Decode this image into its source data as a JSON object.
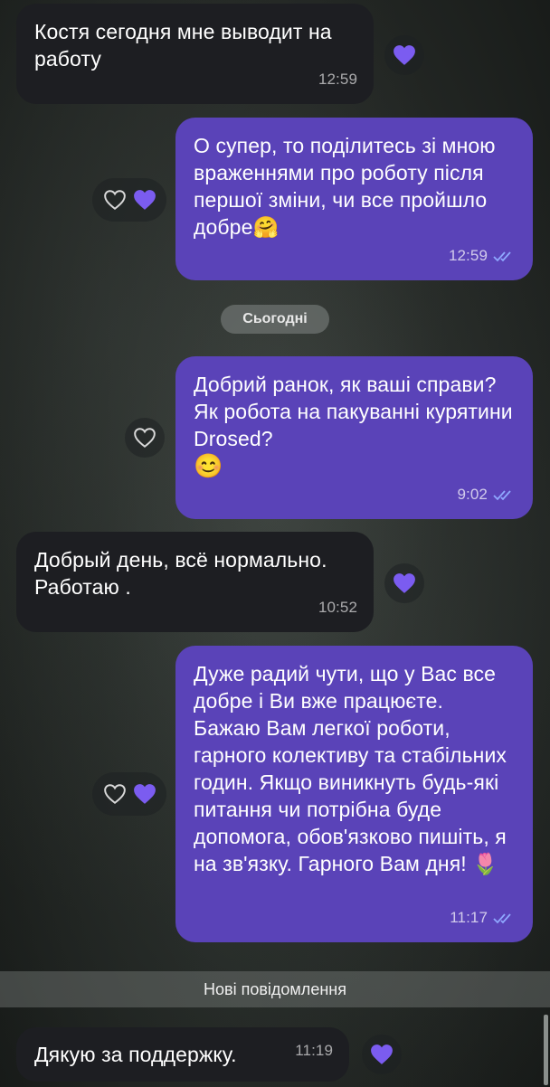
{
  "messages": [
    {
      "text": "Костя сегодня мне выводит на работу",
      "time": "12:59"
    },
    {
      "text": "О супер, то поділитесь зі мною враженнями про роботу після першої зміни, чи все пройшло добре🤗",
      "time": "12:59"
    },
    {
      "text": "Добрий ранок, як ваші справи? Як робота на пакуванні курятини Drosed?",
      "emoji": "😊",
      "time": "9:02"
    },
    {
      "text": "Добрый день, всё нормально. Работаю .",
      "time": "10:52"
    },
    {
      "text": "Дуже радий чути, що у Вас все добре і Ви вже працюєте. Бажаю Вам легкої роботи, гарного колективу та стабільних годин. Якщо виникнуть будь-які питання чи потрібна буде допомога, обов'язково пишіть, я на зв'язку. Гарного Вам дня! 🌷",
      "time": "11:17"
    },
    {
      "text": "Дякую за поддержку.",
      "time": "11:19"
    }
  ],
  "date_divider": "Сьогодні",
  "new_messages_label": "Нові повідомлення",
  "colors": {
    "outgoing_bubble": "#5a43b8",
    "incoming_bubble": "#1d1e22",
    "heart_filled": "#7b5cf0",
    "read_ticks": "#8fa8ff"
  },
  "icons": [
    "heart-filled-icon",
    "heart-outline-icon",
    "double-check-icon"
  ]
}
